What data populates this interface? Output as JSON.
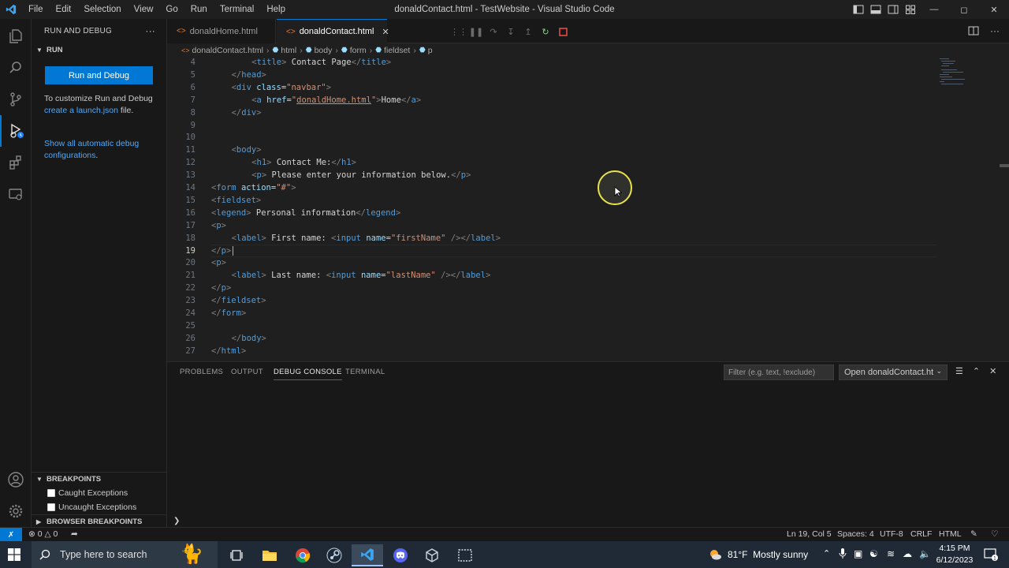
{
  "window": {
    "title": "donaldContact.html - TestWebsite - Visual Studio Code",
    "menu": [
      "File",
      "Edit",
      "Selection",
      "View",
      "Go",
      "Run",
      "Terminal",
      "Help"
    ]
  },
  "sidebar": {
    "header": "RUN AND DEBUG",
    "run_section": "RUN",
    "run_button": "Run and Debug",
    "customize_text_1": "To customize Run and Debug ",
    "customize_link": "create a launch.json",
    "customize_text_2": " file.",
    "show_all_link": "Show all automatic debug configurations",
    "show_all_tail": ".",
    "breakpoints_section": "BREAKPOINTS",
    "breakpoints": [
      {
        "label": "Caught Exceptions",
        "checked": false
      },
      {
        "label": "Uncaught Exceptions",
        "checked": false
      }
    ],
    "browser_breakpoints_section": "BROWSER BREAKPOINTS"
  },
  "tabs": [
    {
      "label": "donaldHome.html",
      "active": false
    },
    {
      "label": "donaldContact.html",
      "active": true
    }
  ],
  "breadcrumb": [
    "donaldContact.html",
    "html",
    "body",
    "form",
    "fieldset",
    "p"
  ],
  "editor": {
    "current_line": 19,
    "lines": [
      {
        "n": "4",
        "indent": 2,
        "html": "<span class='t'>&lt;</span><span class='tg'>title</span><span class='t'>&gt;</span><span class='tx'> Contact Page</span><span class='t'>&lt;/</span><span class='tg'>title</span><span class='t'>&gt;</span>"
      },
      {
        "n": "5",
        "indent": 1,
        "html": "<span class='t'>&lt;/</span><span class='tg'>head</span><span class='t'>&gt;</span>"
      },
      {
        "n": "6",
        "indent": 1,
        "html": "<span class='t'>&lt;</span><span class='tg'>div</span> <span class='at'>class</span><span class='tx'>=</span><span class='st'>\"navbar\"</span><span class='t'>&gt;</span>"
      },
      {
        "n": "7",
        "indent": 2,
        "html": "<span class='t'>&lt;</span><span class='tg'>a</span> <span class='at'>href</span><span class='tx'>=</span><span class='st'>\"</span><span class='lnk'>donaldHome.html</span><span class='st'>\"</span><span class='t'>&gt;</span><span class='tx'>Home</span><span class='t'>&lt;/</span><span class='tg'>a</span><span class='t'>&gt;</span>"
      },
      {
        "n": "8",
        "indent": 1,
        "html": "<span class='t'>&lt;/</span><span class='tg'>div</span><span class='t'>&gt;</span>"
      },
      {
        "n": "9",
        "indent": 0,
        "html": ""
      },
      {
        "n": "10",
        "indent": 0,
        "html": ""
      },
      {
        "n": "11",
        "indent": 1,
        "html": "<span class='t'>&lt;</span><span class='tg'>body</span><span class='t'>&gt;</span>"
      },
      {
        "n": "12",
        "indent": 2,
        "html": "<span class='t'>&lt;</span><span class='tg'>h1</span><span class='t'>&gt;</span><span class='tx'> Contact Me:</span><span class='t'>&lt;/</span><span class='tg'>h1</span><span class='t'>&gt;</span>"
      },
      {
        "n": "13",
        "indent": 2,
        "html": "<span class='t'>&lt;</span><span class='tg'>p</span><span class='t'>&gt;</span><span class='tx'> Please enter your information below.</span><span class='t'>&lt;/</span><span class='tg'>p</span><span class='t'>&gt;</span>"
      },
      {
        "n": "14",
        "indent": 0,
        "html": "<span class='t'>&lt;</span><span class='tg'>form</span> <span class='at'>action</span><span class='tx'>=</span><span class='st'>\"#\"</span><span class='t'>&gt;</span>"
      },
      {
        "n": "15",
        "indent": 0,
        "html": "<span class='t'>&lt;</span><span class='tg'>fieldset</span><span class='t'>&gt;</span>"
      },
      {
        "n": "16",
        "indent": 0,
        "html": "<span class='t'>&lt;</span><span class='tg'>legend</span><span class='t'>&gt;</span><span class='tx'> Personal information</span><span class='t'>&lt;/</span><span class='tg'>legend</span><span class='t'>&gt;</span>"
      },
      {
        "n": "17",
        "indent": 0,
        "html": "<span class='t'>&lt;</span><span class='tg'>p</span><span class='t'>&gt;</span>"
      },
      {
        "n": "18",
        "indent": 1,
        "html": "<span class='t'>&lt;</span><span class='tg'>label</span><span class='t'>&gt;</span><span class='tx'> First name: </span><span class='t'>&lt;</span><span class='tg'>input</span> <span class='at'>name</span><span class='tx'>=</span><span class='st'>\"firstName\"</span> <span class='t'>/&gt;&lt;/</span><span class='tg'>label</span><span class='t'>&gt;</span>"
      },
      {
        "n": "19",
        "indent": 0,
        "html": "<span class='t'>&lt;/</span><span class='tg'>p</span><span class='t'>&gt;</span>"
      },
      {
        "n": "20",
        "indent": 0,
        "html": "<span class='t'>&lt;</span><span class='tg'>p</span><span class='t'>&gt;</span>"
      },
      {
        "n": "21",
        "indent": 1,
        "html": "<span class='t'>&lt;</span><span class='tg'>label</span><span class='t'>&gt;</span><span class='tx'> Last name: </span><span class='t'>&lt;</span><span class='tg'>input</span> <span class='at'>name</span><span class='tx'>=</span><span class='st'>\"lastName\"</span> <span class='t'>/&gt;&lt;/</span><span class='tg'>label</span><span class='t'>&gt;</span>"
      },
      {
        "n": "22",
        "indent": 0,
        "html": "<span class='t'>&lt;/</span><span class='tg'>p</span><span class='t'>&gt;</span>"
      },
      {
        "n": "23",
        "indent": 0,
        "html": "<span class='t'>&lt;/</span><span class='tg'>fieldset</span><span class='t'>&gt;</span>"
      },
      {
        "n": "24",
        "indent": 0,
        "html": "<span class='t'>&lt;/</span><span class='tg'>form</span><span class='t'>&gt;</span>"
      },
      {
        "n": "25",
        "indent": 0,
        "html": ""
      },
      {
        "n": "26",
        "indent": 1,
        "html": "<span class='t'>&lt;/</span><span class='tg'>body</span><span class='t'>&gt;</span>"
      },
      {
        "n": "27",
        "indent": 0,
        "html": "<span class='t'>&lt;/</span><span class='tg'>html</span><span class='t'>&gt;</span>"
      }
    ]
  },
  "panel": {
    "tabs": [
      "PROBLEMS",
      "OUTPUT",
      "DEBUG CONSOLE",
      "TERMINAL"
    ],
    "active_tab": "DEBUG CONSOLE",
    "filter_placeholder": "Filter (e.g. text, !exclude)",
    "console_select": "Open donaldContact.ht"
  },
  "statusbar": {
    "errors": "0",
    "warnings": "0",
    "position": "Ln 19, Col 5",
    "spaces": "Spaces: 4",
    "encoding": "UTF-8",
    "eol": "CRLF",
    "language": "HTML"
  },
  "taskbar": {
    "search_placeholder": "Type here to search",
    "weather": "81°F  Mostly sunny",
    "time": "4:15 PM",
    "date": "6/12/2023",
    "notifications": "1",
    "apps": [
      "file-explorer",
      "chrome",
      "steam",
      "vscode",
      "discord",
      "virtualbox",
      "snipping-tool"
    ]
  },
  "colors": {
    "accent": "#0078d4",
    "editor_bg": "#1f1f1f",
    "sidebar_bg": "#181818",
    "taskbar_bg": "#1f2a36"
  }
}
